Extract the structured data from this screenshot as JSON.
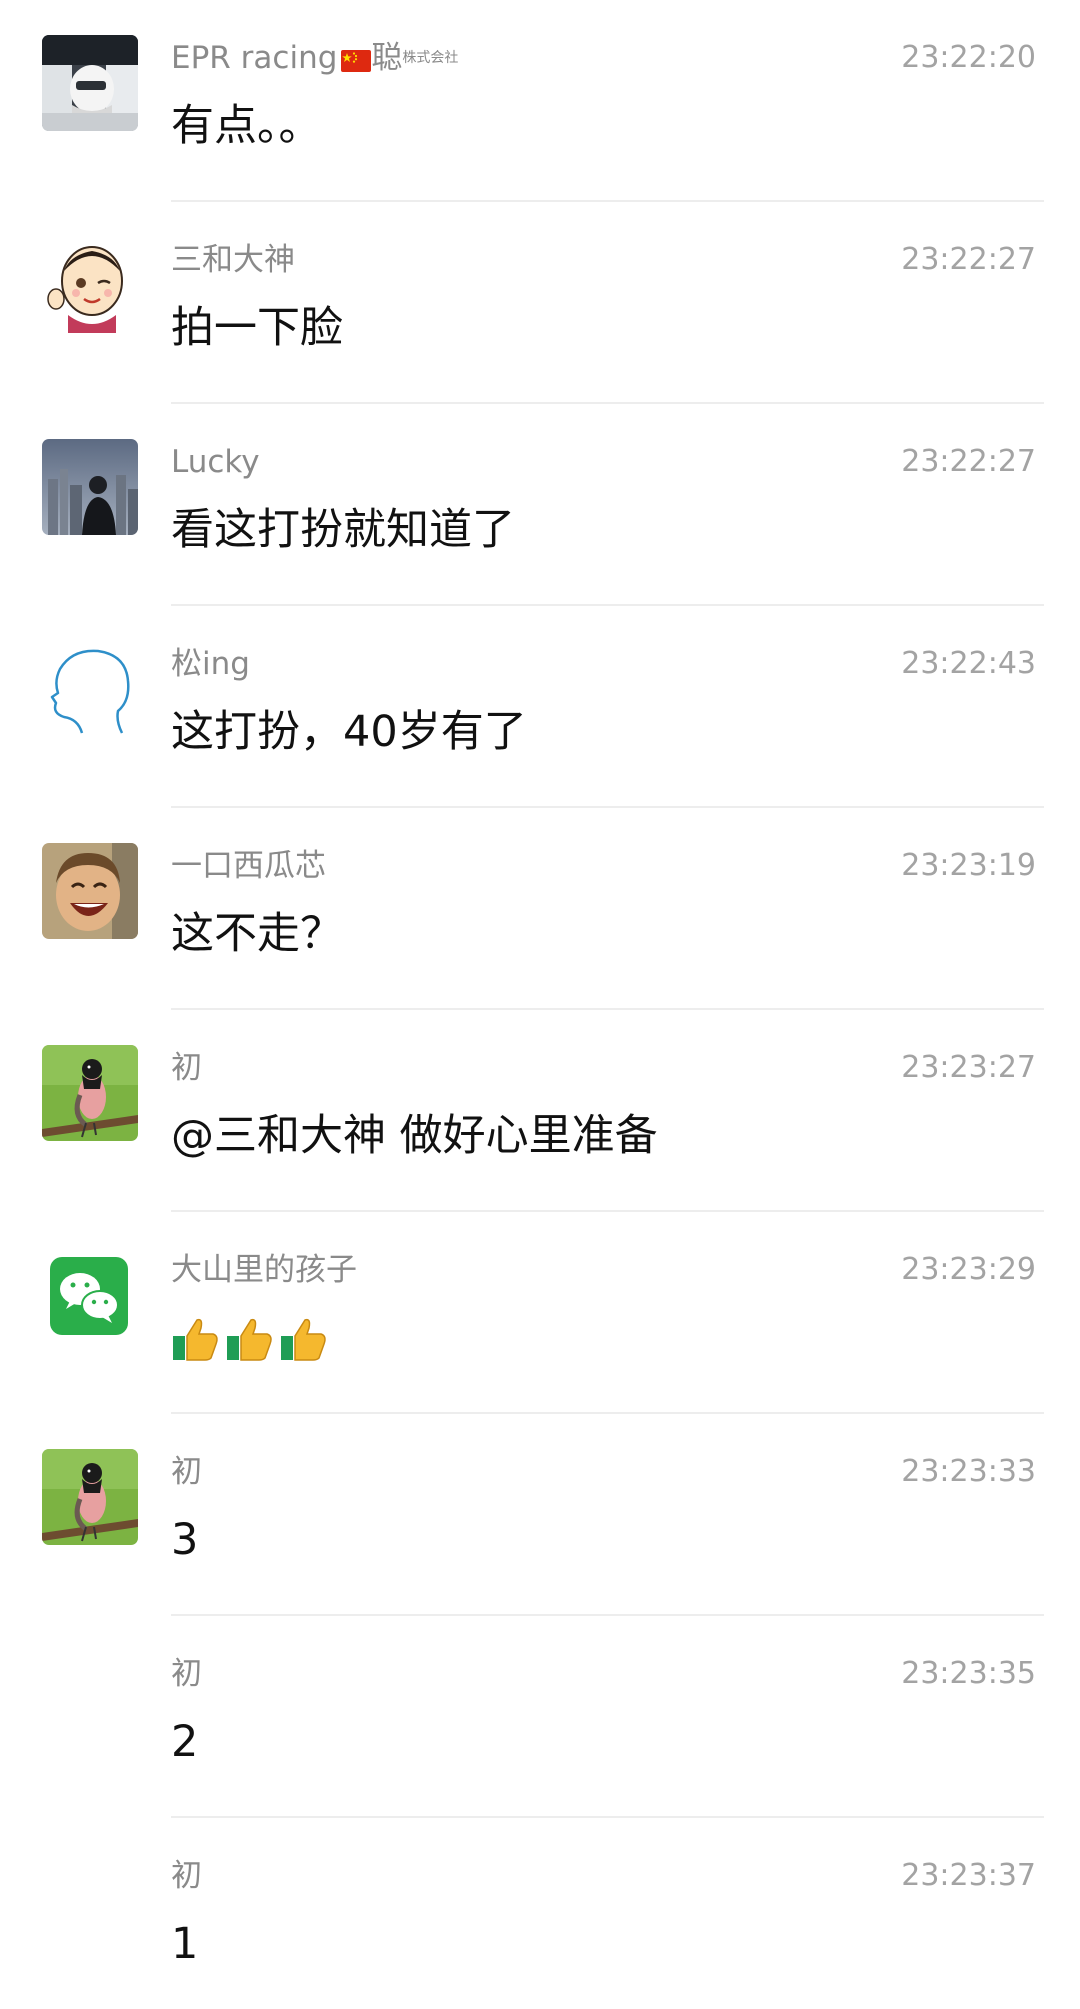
{
  "messages": [
    {
      "sender": "EPR racing",
      "sender_suffix": "聪",
      "sender_tag": "株式会社",
      "time": "23:22:20",
      "text": "有点。。",
      "avatar": "race-driver-helmet-avatar"
    },
    {
      "sender": "三和大神",
      "time": "23:22:27",
      "text": "拍一下脸",
      "avatar": "cartoon-kid-avatar"
    },
    {
      "sender": "Lucky",
      "time": "23:22:27",
      "text": "看这打扮就知道了",
      "avatar": "city-skyline-man-avatar"
    },
    {
      "sender": "松ing",
      "time": "23:22:43",
      "text": "这打扮，40岁有了",
      "avatar": "head-outline-avatar"
    },
    {
      "sender": "一口西瓜芯",
      "time": "23:23:19",
      "text": "这不走？",
      "avatar": "laughing-child-avatar"
    },
    {
      "sender": "初",
      "time": "23:23:27",
      "text": "@三和大神 做好心里准备",
      "avatar": "bird-on-branch-avatar"
    },
    {
      "sender": "大山里的孩子",
      "time": "23:23:29",
      "text": "",
      "emojis": [
        "thumbs-up",
        "thumbs-up",
        "thumbs-up"
      ],
      "avatar": "wechat-logo-avatar"
    },
    {
      "sender": "初",
      "time": "23:23:33",
      "text": "3",
      "avatar": "bird-on-branch-avatar"
    },
    {
      "sender": "初",
      "time": "23:23:35",
      "text": "2",
      "avatar": ""
    },
    {
      "sender": "初",
      "time": "23:23:37",
      "text": "1",
      "avatar": ""
    }
  ],
  "colors": {
    "sender": "#8a8a8a",
    "time": "#a3a3a3",
    "text": "#111111",
    "divider": "#ededed",
    "wechat_green": "#2aae4a"
  }
}
